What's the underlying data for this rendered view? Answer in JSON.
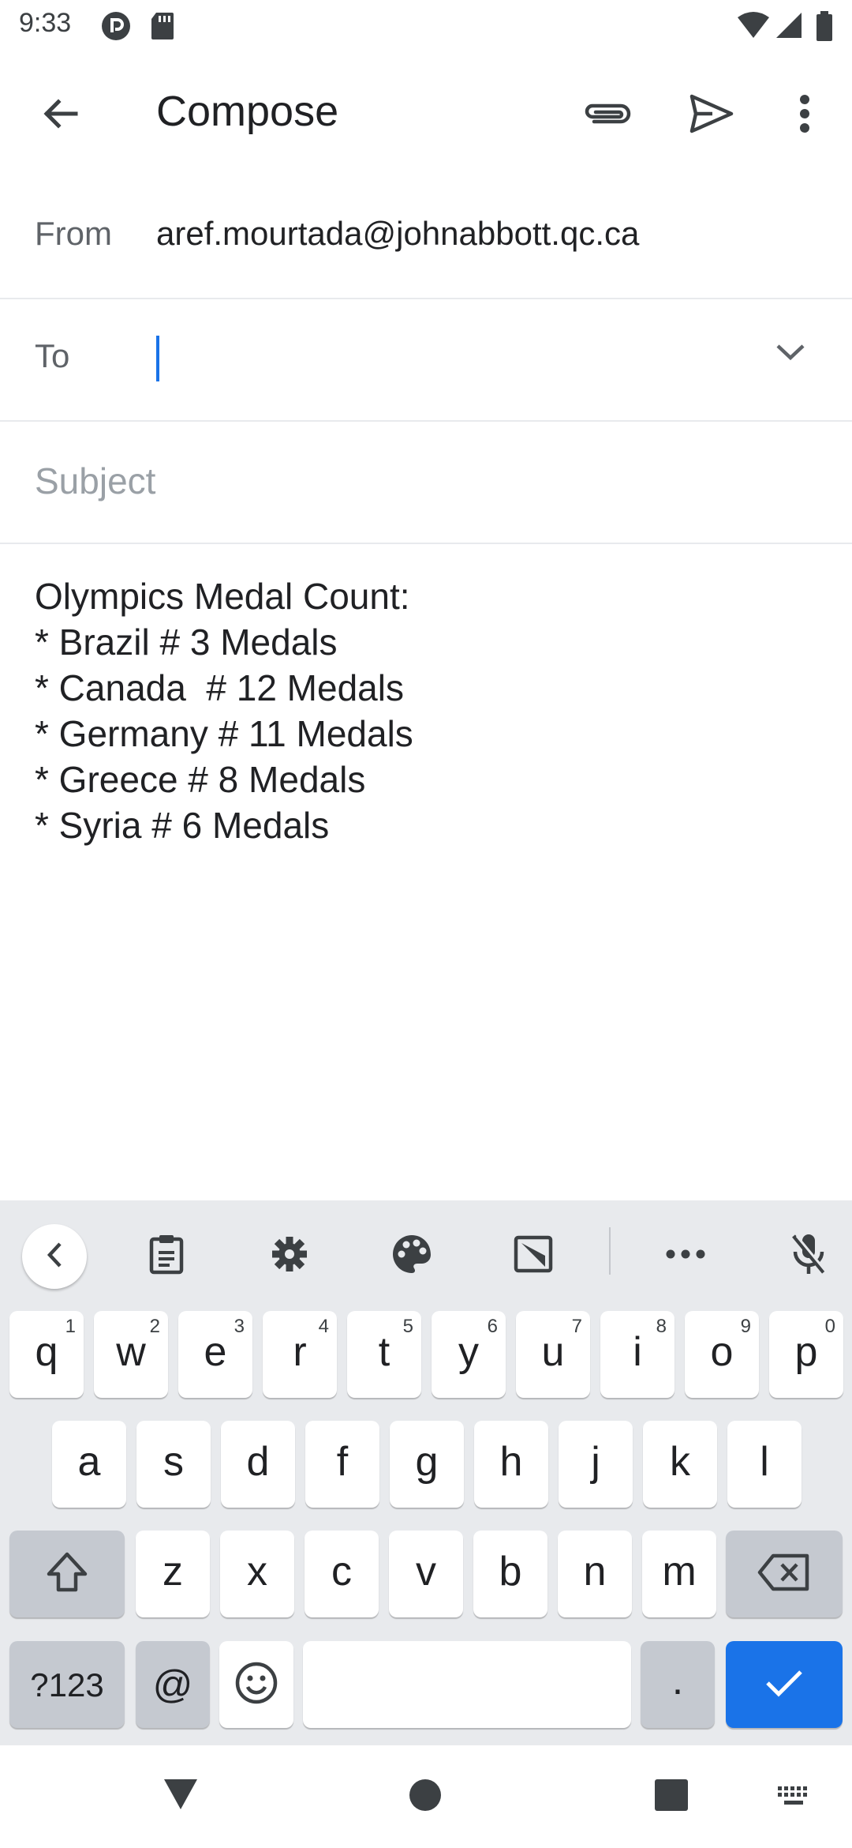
{
  "status_bar": {
    "time": "9:33",
    "icons": [
      "pocket-casts-icon",
      "sd-card-icon",
      "wifi-icon",
      "signal-icon",
      "battery-icon"
    ]
  },
  "toolbar": {
    "title": "Compose",
    "back_icon": "arrow-back-icon",
    "attach_icon": "paperclip-icon",
    "send_icon": "send-icon",
    "more_icon": "more-vert-icon"
  },
  "compose": {
    "from_label": "From",
    "from_value": "aref.mourtada@johnabbott.qc.ca",
    "to_label": "To",
    "to_value": "",
    "subject_placeholder": "Subject",
    "body": "Olympics Medal Count:\n* Brazil # 3 Medals\n* Canada  # 12 Medals\n* Germany # 11 Medals\n* Greece # 8 Medals\n* Syria # 6 Medals"
  },
  "keyboard": {
    "toolbar_icons": [
      "chevron-left-icon",
      "clipboard-icon",
      "settings-icon",
      "palette-icon",
      "floating-keyboard-icon",
      "more-horiz-icon",
      "mic-off-icon"
    ],
    "row1": [
      {
        "key": "q",
        "hint": "1"
      },
      {
        "key": "w",
        "hint": "2"
      },
      {
        "key": "e",
        "hint": "3"
      },
      {
        "key": "r",
        "hint": "4"
      },
      {
        "key": "t",
        "hint": "5"
      },
      {
        "key": "y",
        "hint": "6"
      },
      {
        "key": "u",
        "hint": "7"
      },
      {
        "key": "i",
        "hint": "8"
      },
      {
        "key": "o",
        "hint": "9"
      },
      {
        "key": "p",
        "hint": "0"
      }
    ],
    "row2": [
      "a",
      "s",
      "d",
      "f",
      "g",
      "h",
      "j",
      "k",
      "l"
    ],
    "row3": [
      "z",
      "x",
      "c",
      "v",
      "b",
      "n",
      "m"
    ],
    "symbols_label": "?123",
    "at_label": "@",
    "period_label": ".",
    "colors": {
      "accent": "#1a73e8",
      "function_key": "#c5c9d0",
      "background": "#e8eaed"
    }
  },
  "nav_bar": {
    "icons": [
      "back-triangle-icon",
      "home-circle-icon",
      "recents-square-icon",
      "keyboard-switch-icon"
    ]
  }
}
